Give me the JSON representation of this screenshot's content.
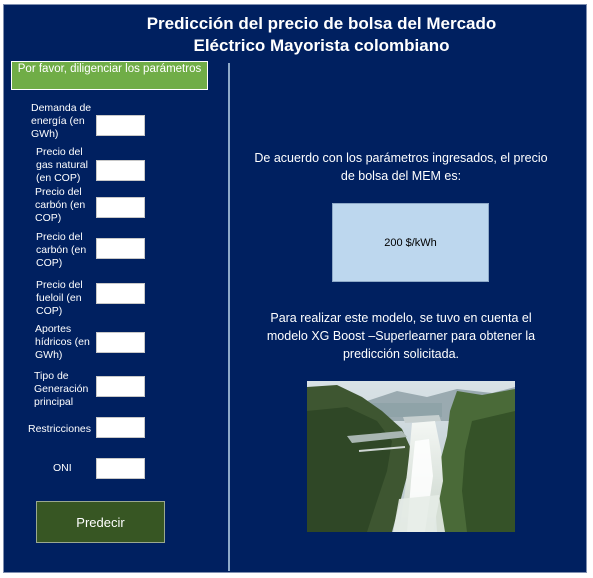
{
  "title": {
    "line1": "Predicción del precio de bolsa del Mercado",
    "line2": "Eléctrico Mayorista colombiano"
  },
  "params_banner": "Por favor, diligenciar los parámetros",
  "params": [
    {
      "label": "Demanda de energía (en GWh)",
      "value": ""
    },
    {
      "label": "Precio del gas natural (en COP)",
      "value": ""
    },
    {
      "label": "Precio del carbón (en COP)",
      "value": ""
    },
    {
      "label": "Precio del carbón (en COP)",
      "value": ""
    },
    {
      "label": "Precio del fueloil (en COP)",
      "value": ""
    },
    {
      "label": "Aportes hídricos (en GWh)",
      "value": ""
    },
    {
      "label": "Tipo de Generación principal",
      "value": ""
    },
    {
      "label": "Restricciones",
      "value": ""
    },
    {
      "label": "ONI",
      "value": ""
    }
  ],
  "predict_button": "Predecir",
  "result_intro": "De acuerdo con los parámetros ingresados, el precio de bolsa del MEM es:",
  "result_value": "200 $/kWh",
  "model_note": "Para realizar este modelo, se tuvo en cuenta el modelo XG Boost –Superlearner para obtener la predicción solicitada.",
  "colors": {
    "background": "#002060",
    "banner": "#70ad47",
    "button": "#375623",
    "result_box": "#bdd7ee"
  }
}
